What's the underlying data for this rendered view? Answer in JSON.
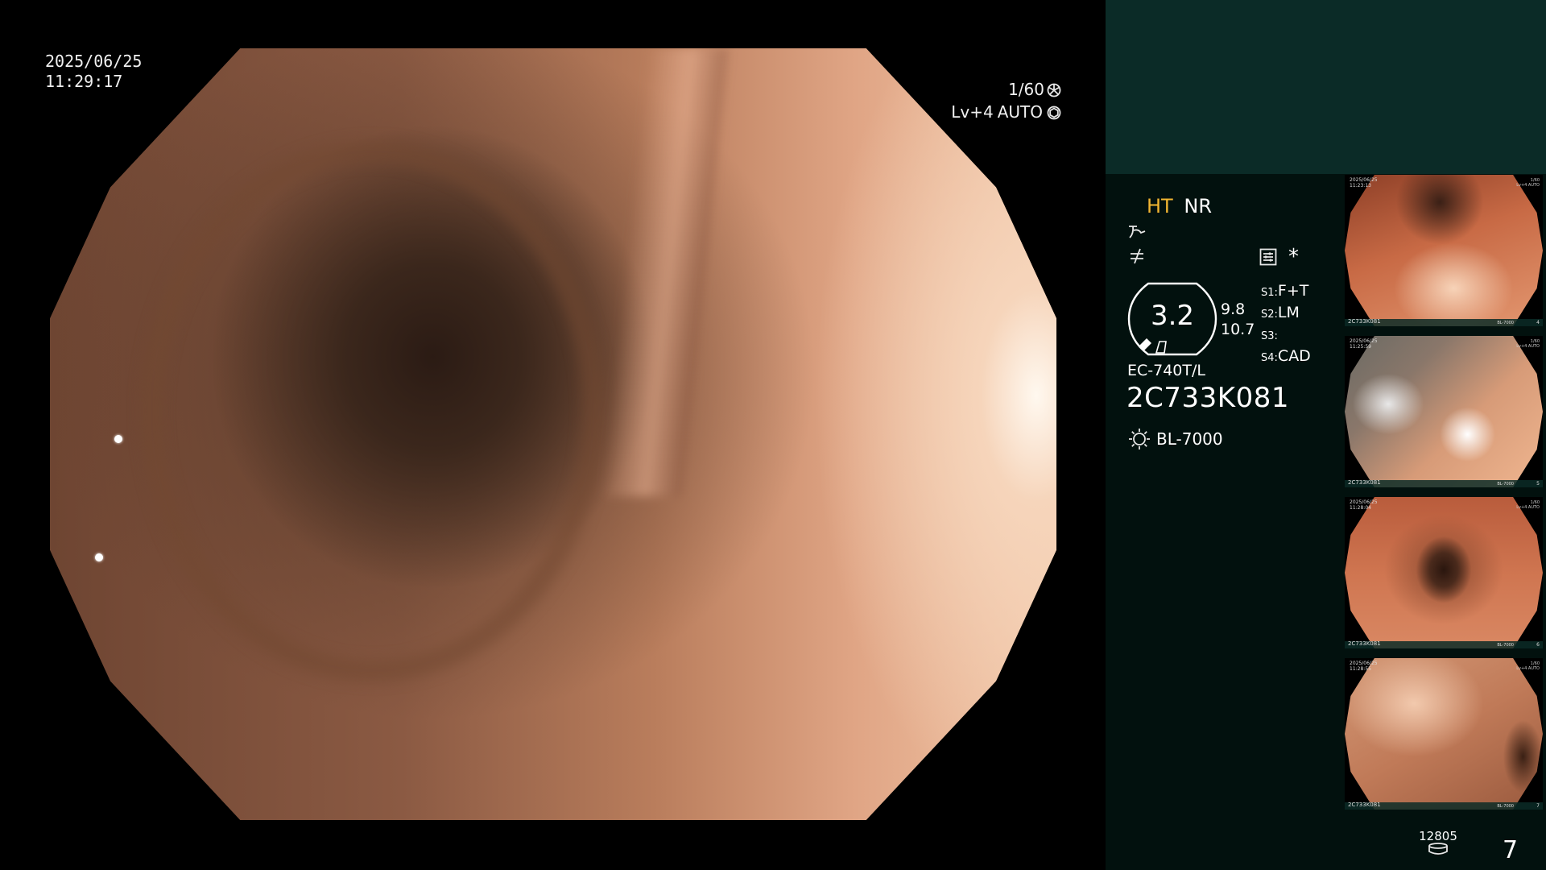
{
  "datetime": {
    "date": "2025/06/25",
    "time": "11:29:17"
  },
  "exposure": {
    "shutter": "1/60",
    "level": "Lv+4",
    "mode": "AUTO"
  },
  "panel": {
    "mode_ht": "HT",
    "mode_nr": "NR",
    "zoom_value": "3.2",
    "readout_1": "9.8",
    "readout_2": "10.7",
    "asterisk": "*",
    "scope_model": "EC-740T/L",
    "scope_serial": "2C733K081",
    "light_source": "BL-7000",
    "switches": [
      {
        "key": "S1",
        "value": "F+T"
      },
      {
        "key": "S2",
        "value": "LM"
      },
      {
        "key": "S3",
        "value": ""
      },
      {
        "key": "S4",
        "value": "CAD"
      }
    ],
    "storage_count": "12805",
    "capture_count": "7"
  },
  "thumbnails": [
    {
      "date": "2025/06/25",
      "time": "11:23:13",
      "serial": "2C733K081",
      "right_line1": "1/60",
      "right_line2": "Lv+4 AUTO",
      "light": "BL-7000",
      "index": "4"
    },
    {
      "date": "2025/06/25",
      "time": "11:25:59",
      "serial": "2C733K081",
      "right_line1": "1/60",
      "right_line2": "Lv+4 AUTO",
      "light": "BL-7000",
      "index": "5"
    },
    {
      "date": "2025/06/25",
      "time": "11:28:04",
      "serial": "2C733K081",
      "right_line1": "1/60",
      "right_line2": "Lv+4 AUTO",
      "light": "BL-7000",
      "index": "6"
    },
    {
      "date": "2025/06/25",
      "time": "11:28:55",
      "serial": "2C733K081",
      "right_line1": "1/60",
      "right_line2": "Lv+4 AUTO",
      "light": "BL-7000",
      "index": "7"
    }
  ],
  "colors": {
    "accent_ht": "#f2b632",
    "panel_bg": "#02110e",
    "panel_top": "#0b2b27"
  }
}
